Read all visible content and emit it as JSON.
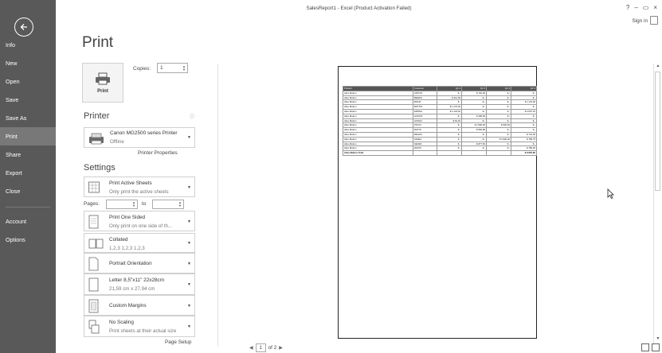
{
  "window": {
    "title": "SalesReport1 - Excel (Product Activation Failed)",
    "help": "?",
    "minimize": "–",
    "restore": "▭",
    "close": "×",
    "sign_in": "Sign in"
  },
  "sidebar": {
    "items": [
      {
        "label": "Info"
      },
      {
        "label": "New"
      },
      {
        "label": "Open"
      },
      {
        "label": "Save"
      },
      {
        "label": "Save As"
      },
      {
        "label": "Print"
      },
      {
        "label": "Share"
      },
      {
        "label": "Export"
      },
      {
        "label": "Close"
      },
      {
        "label": "Account"
      },
      {
        "label": "Options"
      }
    ],
    "active": "Print"
  },
  "print": {
    "title": "Print",
    "button_label": "Print",
    "copies_label": "Copies:",
    "copies_value": "1"
  },
  "printer": {
    "heading": "Printer",
    "name": "Canon MG2500 series Printer",
    "status": "Offline",
    "properties_link": "Printer Properties"
  },
  "settings": {
    "heading": "Settings",
    "scope": {
      "main": "Print Active Sheets",
      "sub": "Only print the active sheets"
    },
    "pages_label": "Pages:",
    "pages_to": "to",
    "sides": {
      "main": "Print One Sided",
      "sub": "Only print on one side of th..."
    },
    "collation": {
      "main": "Collated",
      "sub": "1,2,3   1,2,3   1,2,3"
    },
    "orientation": {
      "main": "Portrait Orientation"
    },
    "paper": {
      "main": "Letter 8,5\"x11\" 22x28cm",
      "sub": "21,59 cm x 27,94 cm"
    },
    "margins": {
      "main": "Custom Margins"
    },
    "scaling": {
      "main": "No Scaling",
      "sub": "Print sheets at their actual size"
    },
    "page_setup_link": "Page Setup"
  },
  "preview": {
    "page_current": "1",
    "page_total": "of 2",
    "sheet": {
      "headers": [
        "Product",
        "Customer",
        "Qtr 1",
        "Qtr 2",
        "Qtr 3",
        "Qtr 4"
      ],
      "rows": [
        [
          "Alice Mutton",
          "ANTON",
          "$      -",
          "$    702,00",
          "$      -",
          "$      -"
        ],
        [
          "Alice Mutton",
          "BERGS",
          "$   312,00",
          "$      -",
          "$      -",
          "$      -"
        ],
        [
          "Alice Mutton",
          "BOLID",
          "$      -",
          "$      -",
          "$      -",
          "$  1.170,00"
        ],
        [
          "Alice Mutton",
          "BOTTM",
          "$  1.170,00",
          "$      -",
          "$      -",
          "$      -"
        ],
        [
          "Alice Mutton",
          "ERNSH",
          "$  1.123,20",
          "$      -",
          "$      -",
          "$  2.607,15"
        ],
        [
          "Alice Mutton",
          "GODOS",
          "$      -",
          "$    280,80",
          "$      -",
          "$      -"
        ],
        [
          "Alice Mutton",
          "HUNGC",
          "$    62,40",
          "$      -",
          "$      -",
          "$      -"
        ],
        [
          "Alice Mutton",
          "PICCO",
          "$      -",
          "$  1.560,00",
          "$    936,00",
          "$      -"
        ],
        [
          "Alice Mutton",
          "RATTC",
          "$      -",
          "$    592,80",
          "$      -",
          "$      -"
        ],
        [
          "Alice Mutton",
          "REGGC",
          "$      -",
          "$      -",
          "$      -",
          "$    741,00"
        ],
        [
          "Alice Mutton",
          "SAVEA",
          "$      -",
          "$      -",
          "$  3.900,00",
          "$    789,75"
        ],
        [
          "Alice Mutton",
          "SEVES",
          "$      -",
          "$    877,50",
          "$      -",
          "$      -"
        ],
        [
          "Alice Mutton",
          "WHITC",
          "$      -",
          "$      -",
          "$      -",
          "$    780,00"
        ]
      ],
      "total": [
        "Alice Mutton Total",
        "",
        "",
        "",
        "",
        "$  6.087,90"
      ]
    }
  }
}
